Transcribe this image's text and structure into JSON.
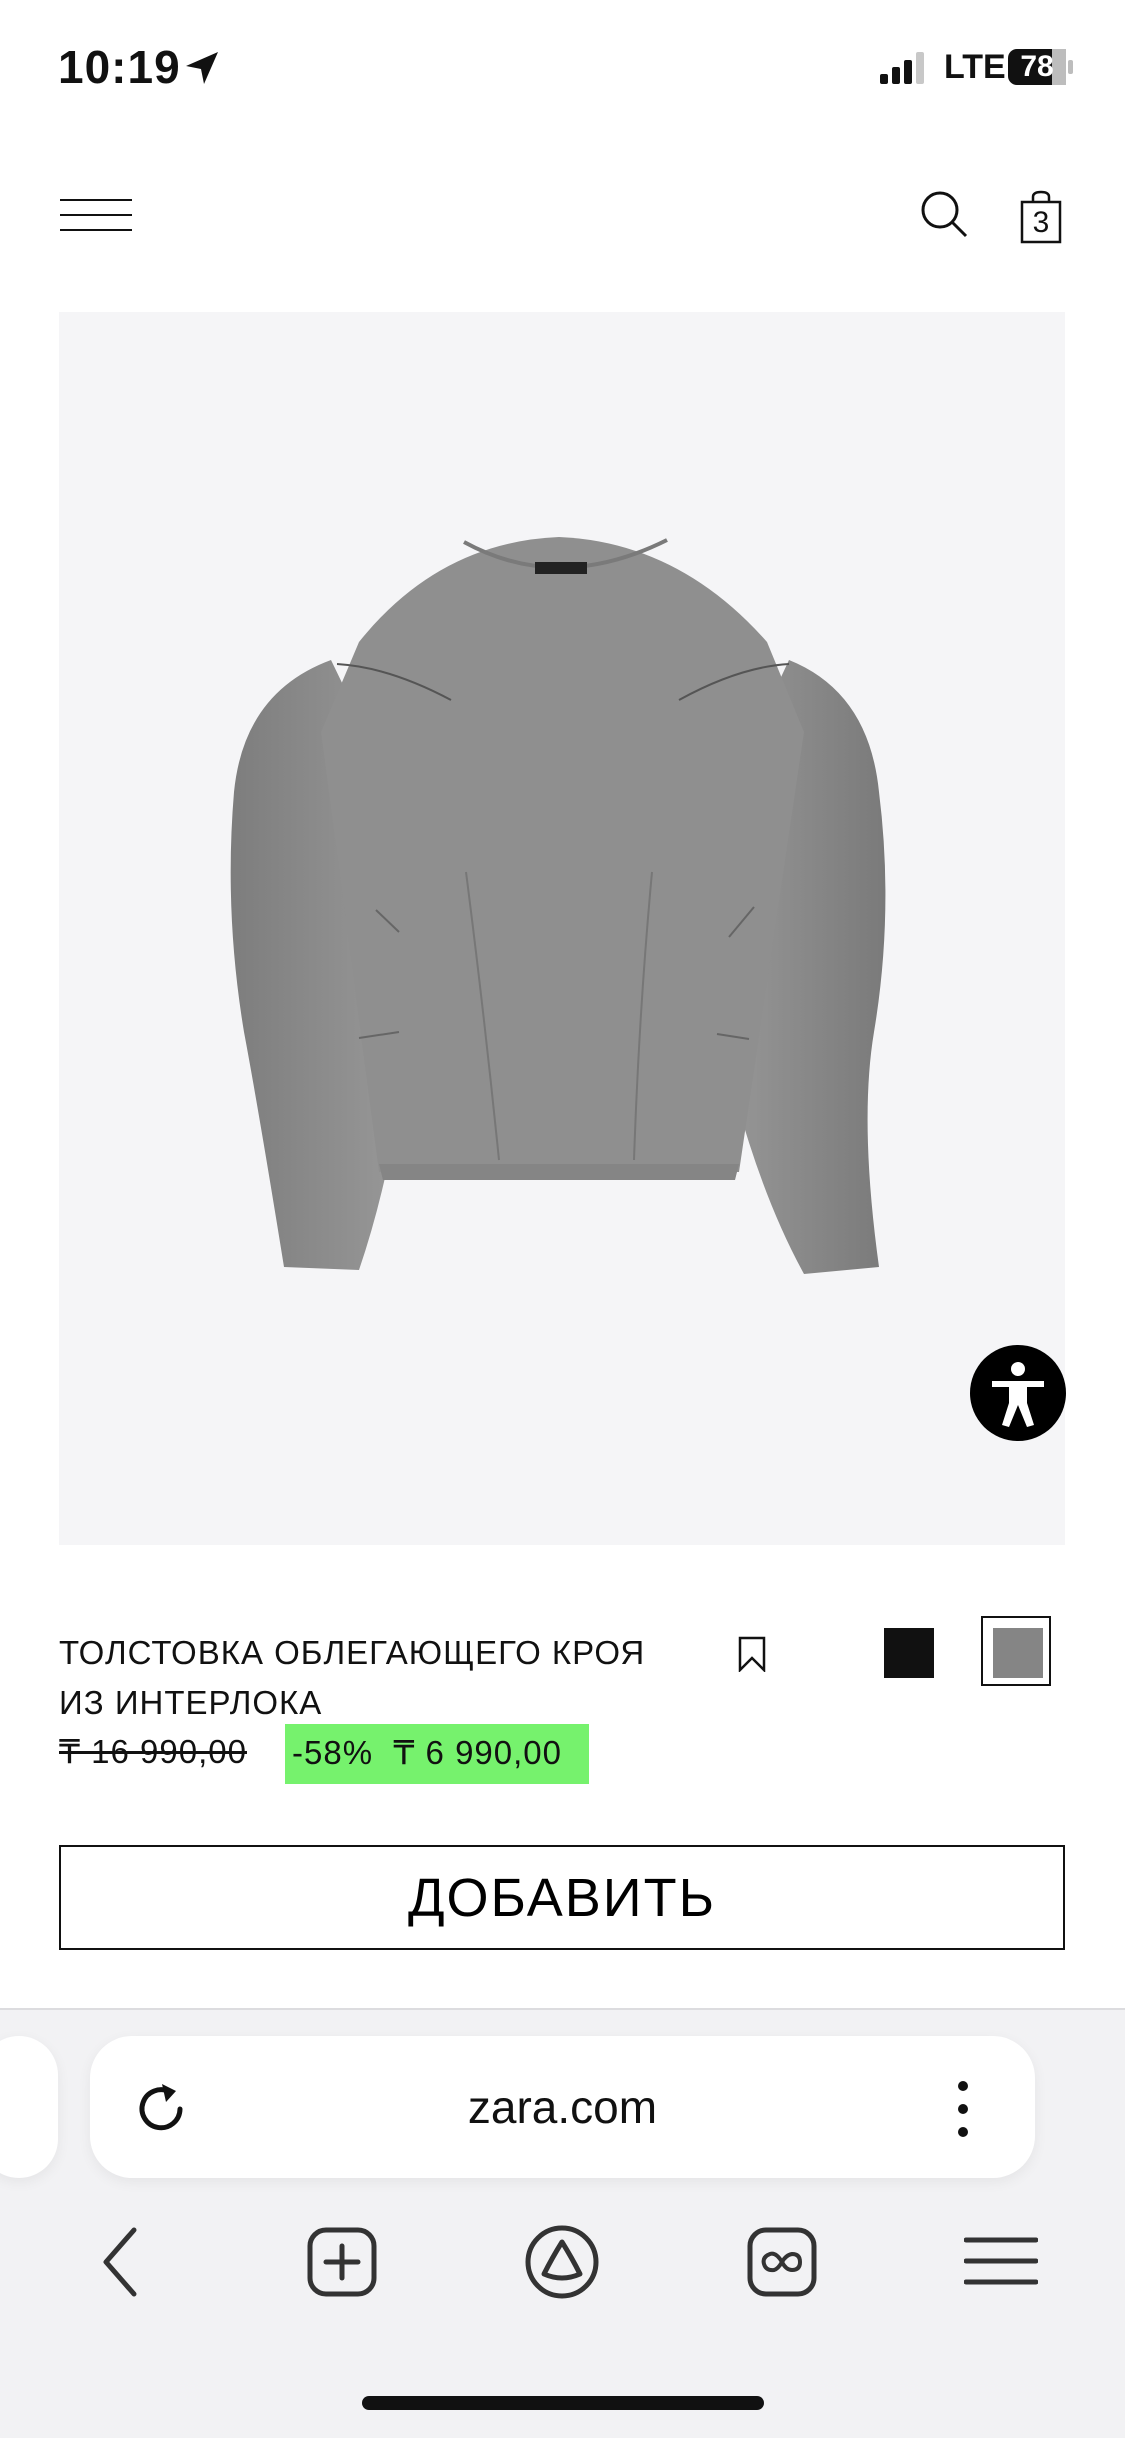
{
  "status_bar": {
    "time": "10:19",
    "network": "LTE",
    "battery": "78"
  },
  "header": {
    "cart_count": "3"
  },
  "product": {
    "title_line1": "ТОЛСТОВКА ОБЛЕГАЮЩЕГО КРОЯ",
    "title_line2": "ИЗ ИНТЕРЛОКА",
    "old_price": "₸ 16 990,00",
    "discount": "-58%",
    "price": "₸ 6 990,00",
    "colors": [
      "#111111",
      "#858585"
    ],
    "selected_color_index": 1
  },
  "actions": {
    "add_label": "ДОБАВИТЬ"
  },
  "browser": {
    "url": "zara.com"
  },
  "colors": {
    "sale_badge": "#76f26d",
    "image_background": "#f5f5f7",
    "chrome_background": "#f2f2f4"
  }
}
